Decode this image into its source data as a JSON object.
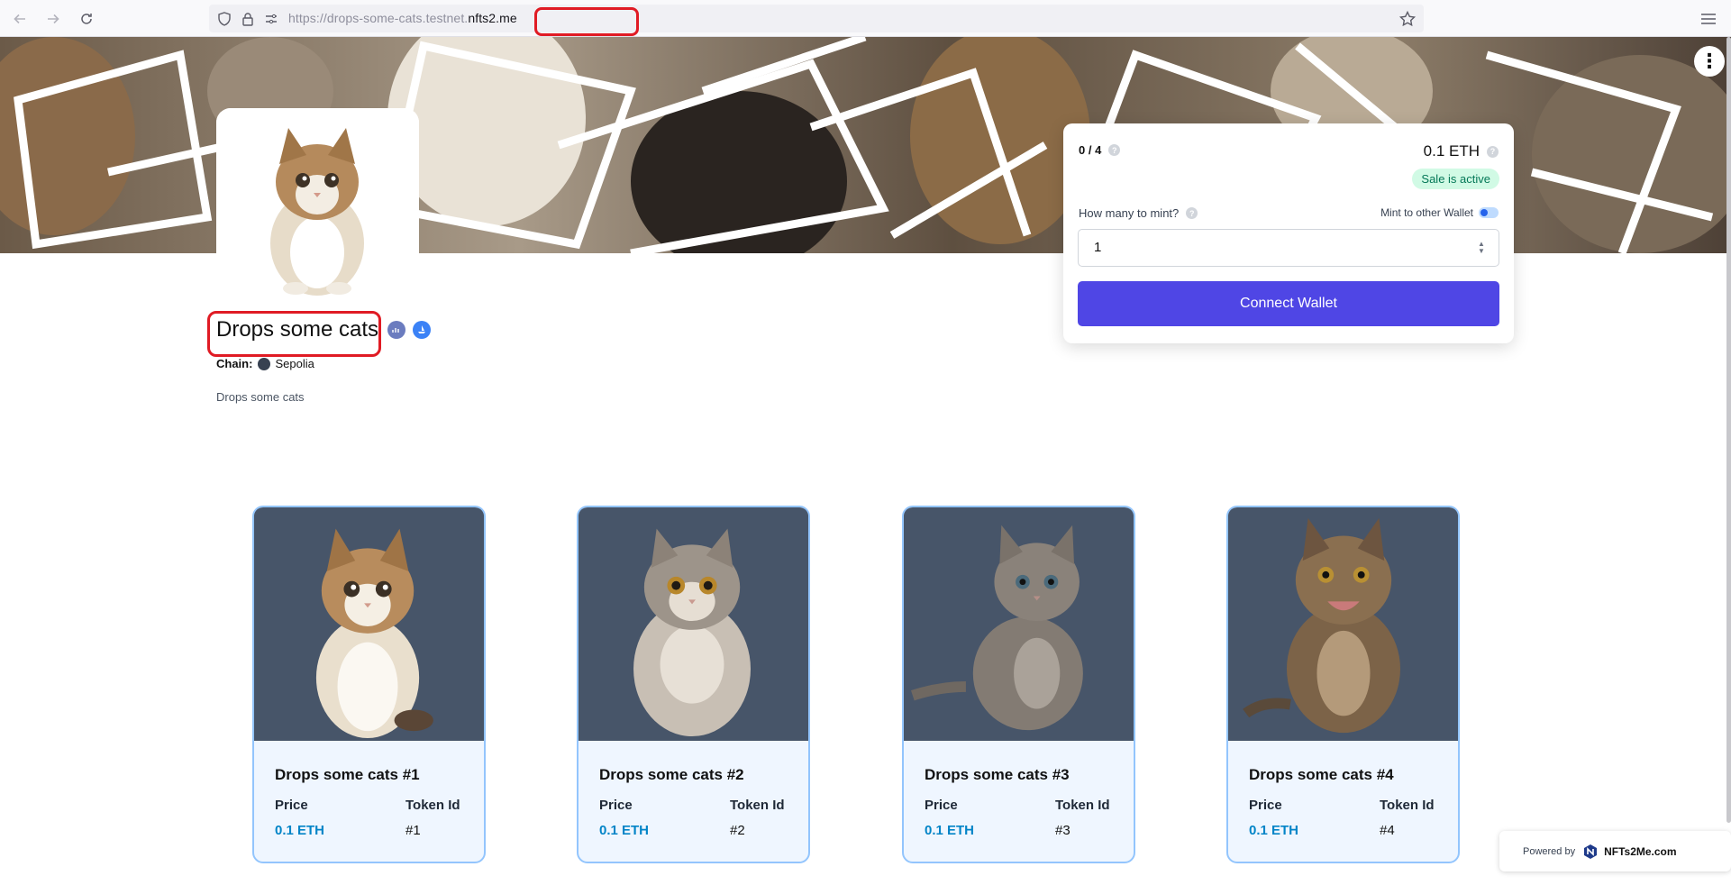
{
  "browser": {
    "url_scheme": "https://",
    "url_subdomain": "drops-some-cats",
    "url_mid": ".testnet.",
    "url_domain": "nfts2.me",
    "back_icon": "arrow-left-icon",
    "forward_icon": "arrow-right-icon",
    "reload_icon": "reload-icon",
    "menu_icon": "hamburger-menu-icon"
  },
  "collection": {
    "title": "Drops some cats",
    "chain_label": "Chain:",
    "chain_value": "Sepolia",
    "description": "Drops some cats"
  },
  "mint_panel": {
    "supply": "0 / 4",
    "price": "0.1 ETH",
    "sale_status": "Sale is active",
    "how_many_label": "How many to mint?",
    "mint_other_label": "Mint to other Wallet",
    "quantity": "1",
    "connect_label": "Connect Wallet",
    "accent_color": "#4f46e5"
  },
  "nfts": [
    {
      "name": "Drops some cats #1",
      "price_label": "Price",
      "token_label": "Token Id",
      "price": "0.1 ETH",
      "token": "#1"
    },
    {
      "name": "Drops some cats #2",
      "price_label": "Price",
      "token_label": "Token Id",
      "price": "0.1 ETH",
      "token": "#2"
    },
    {
      "name": "Drops some cats #3",
      "price_label": "Price",
      "token_label": "Token Id",
      "price": "0.1 ETH",
      "token": "#3"
    },
    {
      "name": "Drops some cats #4",
      "price_label": "Price",
      "token_label": "Token Id",
      "price": "0.1 ETH",
      "token": "#4"
    }
  ],
  "footer": {
    "powered_by": "Powered by",
    "brand": "NFTs2Me.com"
  }
}
